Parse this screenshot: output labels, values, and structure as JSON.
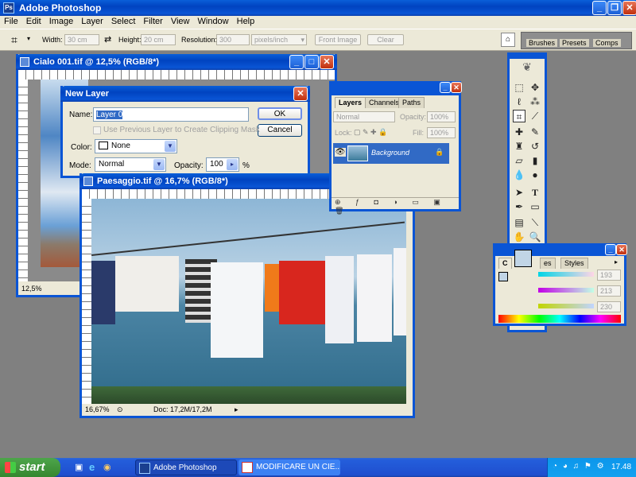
{
  "app": {
    "title": "Adobe Photoshop"
  },
  "menu": [
    "File",
    "Edit",
    "Image",
    "Layer",
    "Select",
    "Filter",
    "View",
    "Window",
    "Help"
  ],
  "options": {
    "width_label": "Width:",
    "width_value": "30 cm",
    "height_label": "Height:",
    "height_value": "20 cm",
    "resolution_label": "Resolution:",
    "resolution_value": "300",
    "resolution_unit": "pixels/inch",
    "front_image": "Front Image",
    "clear": "Clear"
  },
  "panel_well": {
    "tabs": [
      "Brushes",
      "Presets",
      "Comps"
    ]
  },
  "doc1": {
    "title": "Cialo 001.tif @ 12,5% (RGB/8*)",
    "zoom": "12,5%"
  },
  "doc2": {
    "title": "Paesaggio.tif @ 16,7% (RGB/8*)",
    "zoom": "16,67%",
    "doc_info": "Doc: 17,2M/17,2M"
  },
  "new_layer": {
    "title": "New Layer",
    "name_label": "Name:",
    "name_value": "Layer 0",
    "clip_label": "Use Previous Layer to Create Clipping Mask",
    "color_label": "Color:",
    "color_value": "None",
    "mode_label": "Mode:",
    "mode_value": "Normal",
    "opacity_label": "Opacity:",
    "opacity_value": "100",
    "opacity_unit": "%",
    "ok": "OK",
    "cancel": "Cancel"
  },
  "layers": {
    "tabs": [
      "Layers",
      "Channels",
      "Paths"
    ],
    "blend": "Normal",
    "opacity_label": "Opacity:",
    "opacity_value": "100%",
    "lock_label": "Lock:",
    "fill_label": "Fill:",
    "fill_value": "100%",
    "layer_name": "Background"
  },
  "color": {
    "tabs": [
      "C",
      "es",
      "Styles"
    ],
    "r": "193",
    "g": "213",
    "b": "230"
  },
  "taskbar": {
    "start": "start",
    "item1": "Adobe Photoshop",
    "item2": "MODIFICARE UN CIE...",
    "clock": "17.48"
  }
}
